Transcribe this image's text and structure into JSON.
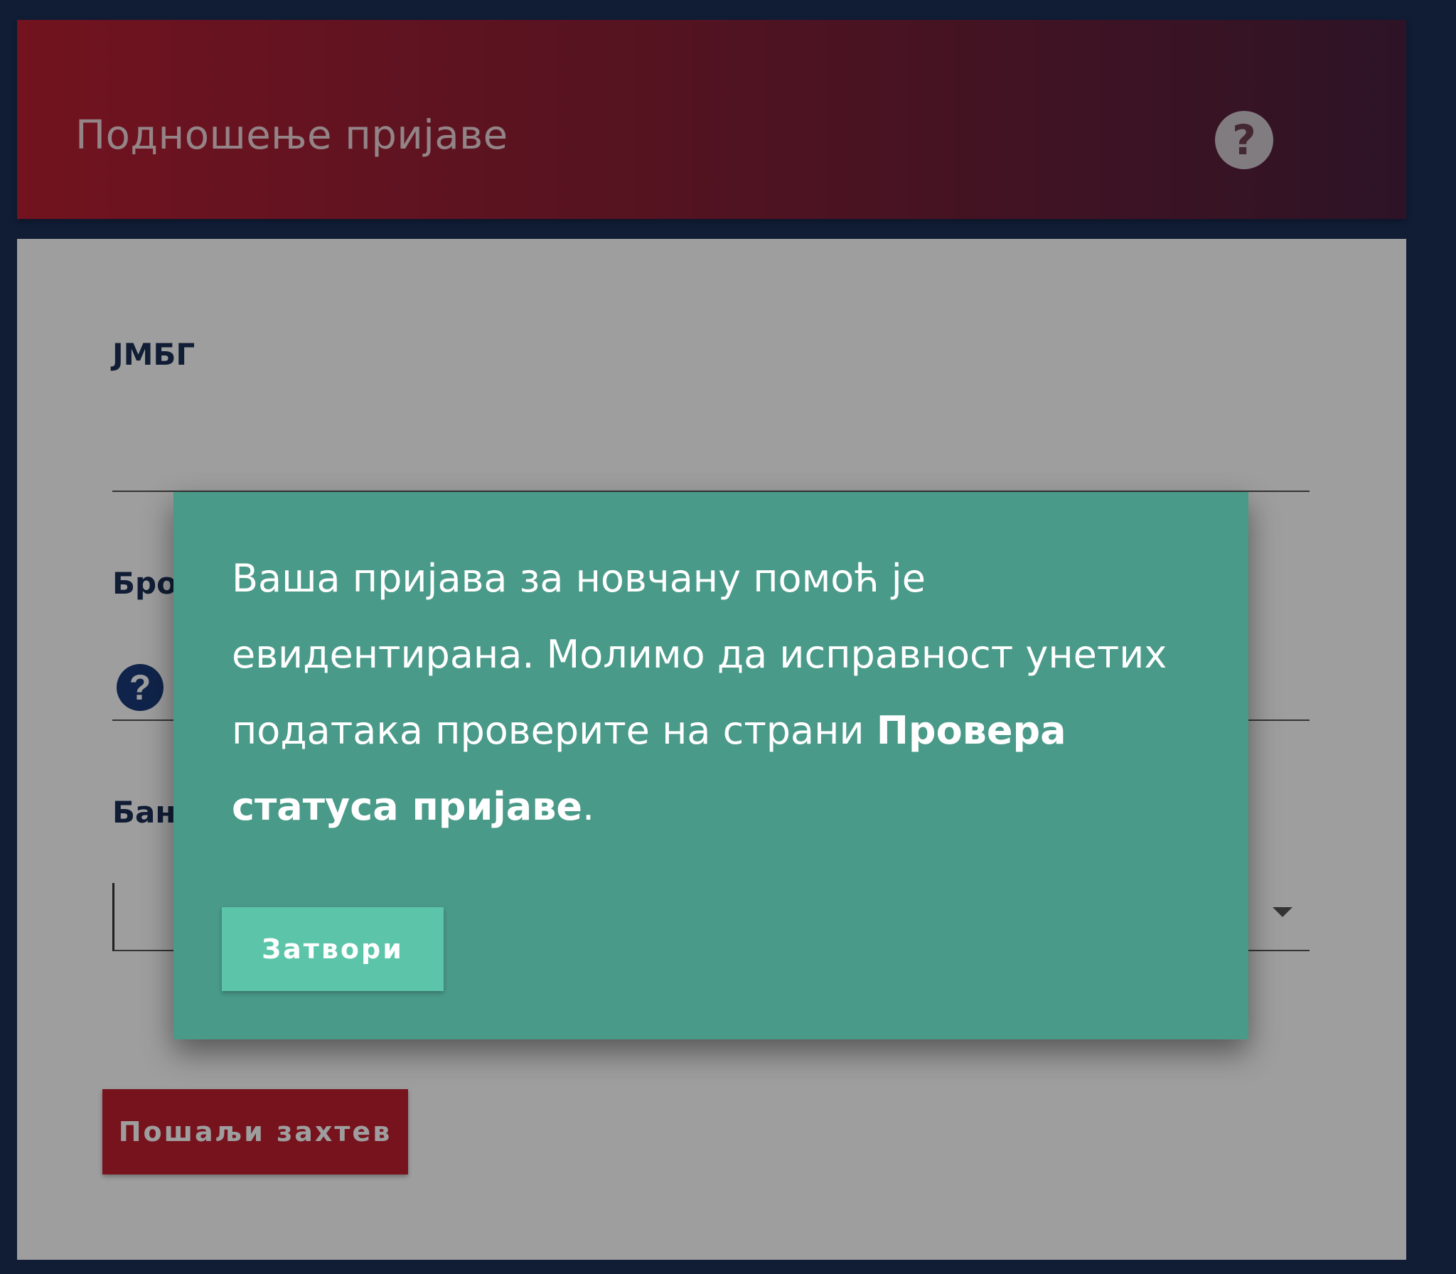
{
  "header": {
    "title": "Подношење пријаве",
    "help_icon": "?"
  },
  "form": {
    "jmbg_label": "ЈМБГ",
    "broj_label": "Бро",
    "broj_help_icon": "?",
    "banka_label": "Бан",
    "submit_label": "Пошаљи захтев"
  },
  "modal": {
    "message_part1": "Ваша пријава за новчану помоћ је евидентирана. Молимо да исправност унетих података проверите на страни ",
    "message_bold": "Провера статуса пријаве",
    "message_end": ".",
    "close_label": "Затвори"
  },
  "colors": {
    "header_start": "#b82033",
    "header_end": "#4a2040",
    "modal_bg": "#4a9a89",
    "close_button": "#5cc5a9",
    "submit_button": "#c0202f",
    "page_bg": "#1b2f56"
  }
}
